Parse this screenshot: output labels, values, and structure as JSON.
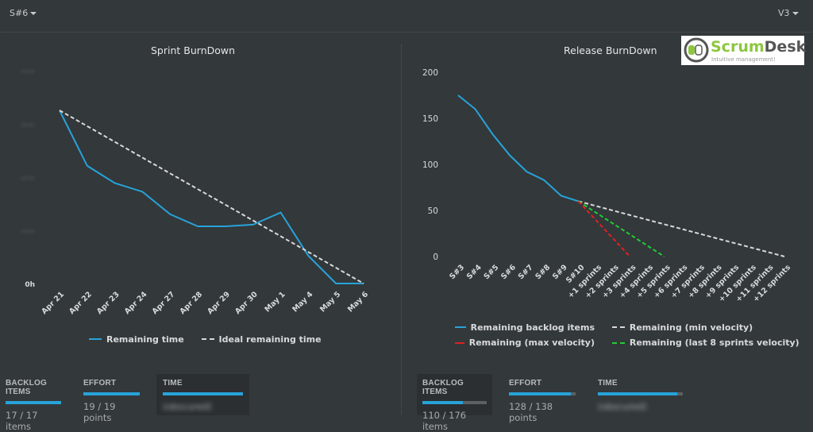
{
  "header": {
    "sprint_selector": "S#6",
    "version_selector": "V3"
  },
  "logo": {
    "brand": "ScrumDesk",
    "tagline": "Intuitive management!",
    "brand_color_1": "#8dc63f",
    "brand_color_2": "#555555"
  },
  "chart_data": [
    {
      "type": "line",
      "title": "Sprint BurnDown",
      "xlabel": "",
      "ylabel": "",
      "y_tick_labels": [
        "(obscured)",
        "(obscured)",
        "(obscured)",
        "(obscured)",
        "0h"
      ],
      "ylim": [
        0,
        100
      ],
      "y_units_note": "relative, tick labels obscured except 0h",
      "categories": [
        "Apr 21",
        "Apr 22",
        "Apr 23",
        "Apr 24",
        "Apr 27",
        "Apr 28",
        "Apr 29",
        "Apr 30",
        "May 1",
        "May 4",
        "May 5",
        "May 6"
      ],
      "series": [
        {
          "name": "Remaining time",
          "color": "#27a3d8",
          "style": "solid",
          "values": [
            100,
            68,
            58,
            53,
            40,
            33,
            33,
            34,
            41,
            16,
            0,
            0
          ]
        },
        {
          "name": "Ideal remaining time",
          "color": "#d9d9d9",
          "style": "dashed",
          "values": [
            100,
            90.9,
            81.8,
            72.7,
            63.6,
            54.5,
            45.5,
            36.4,
            27.3,
            18.2,
            9.1,
            0
          ]
        }
      ],
      "legend": "bottom",
      "grid": false
    },
    {
      "type": "line",
      "title": "Release BurnDown",
      "xlabel": "",
      "ylabel": "",
      "ylim": [
        0,
        200
      ],
      "y_ticks": [
        0,
        50,
        100,
        150,
        200
      ],
      "categories": [
        "S#3",
        "S#4",
        "S#5",
        "S#6",
        "S#7",
        "S#8",
        "S#9",
        "S#10",
        "+1 sprints",
        "+2 sprints",
        "+3 sprints",
        "+4 sprints",
        "+5 sprints",
        "+6 sprints",
        "+7 sprints",
        "+8 sprints",
        "+9 sprints",
        "+10 sprints",
        "+11 sprints",
        "+12 sprints"
      ],
      "series": [
        {
          "name": "Remaining backlog items",
          "color": "#27a3d8",
          "style": "solid",
          "start_index": 0,
          "values": [
            175,
            160,
            133,
            110,
            92,
            83,
            66,
            60
          ]
        },
        {
          "name": "Remaining (min velocity)",
          "color": "#d9d9d9",
          "style": "dashed",
          "start_index": 7,
          "values": [
            60,
            0
          ],
          "end_index": 19
        },
        {
          "name": "Remaining (max velocity)",
          "color": "#e02020",
          "style": "dashed",
          "start_index": 7,
          "values": [
            60,
            0
          ],
          "end_index": 10
        },
        {
          "name": "Remaining (last 8 sprints velocity)",
          "color": "#22cc33",
          "style": "dashed",
          "start_index": 7,
          "values": [
            60,
            0
          ],
          "end_index": 12
        }
      ],
      "legend": "bottom",
      "grid": false
    }
  ],
  "sprint_stats": [
    {
      "label": "BACKLOG ITEMS",
      "value": "17 / 17 items",
      "progress": 1.0,
      "boxed": false
    },
    {
      "label": "EFFORT",
      "value": "19 / 19 points",
      "progress": 1.0,
      "boxed": false
    },
    {
      "label": "TIME",
      "value": "(obscured)",
      "progress": 1.0,
      "boxed": true
    }
  ],
  "release_stats": [
    {
      "label": "BACKLOG ITEMS",
      "value": "110 / 176 items",
      "progress": 0.625,
      "boxed": true
    },
    {
      "label": "EFFORT",
      "value": "128 / 138 points",
      "progress": 0.928,
      "boxed": false
    },
    {
      "label": "TIME",
      "value": "(obscured)",
      "progress": 0.93,
      "boxed": false
    }
  ]
}
